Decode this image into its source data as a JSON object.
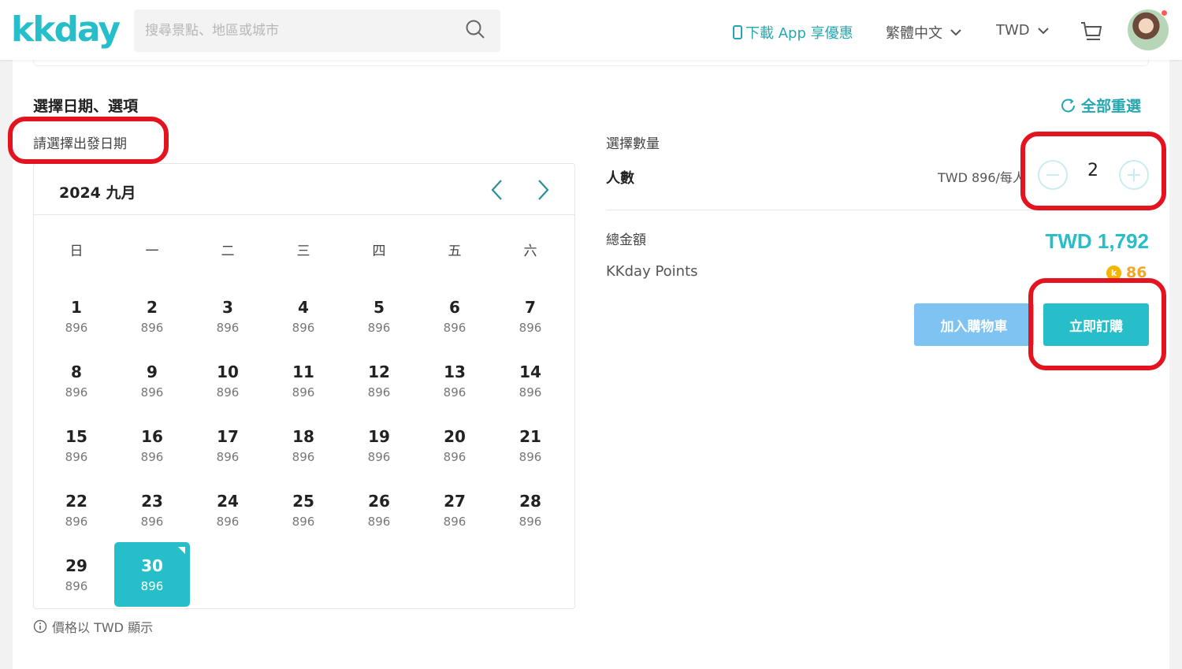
{
  "header": {
    "logo": "kkday",
    "search_placeholder": "搜尋景點、地區或城市",
    "app_link": "下載 App 享優惠",
    "language": "繁體中文",
    "currency": "TWD"
  },
  "booking": {
    "section_title": "選擇日期、選項",
    "reset_label": "全部重選",
    "date_prompt": "請選擇出發日期",
    "price_note": "價格以 TWD 顯示"
  },
  "calendar": {
    "month_label": "2024 九月",
    "weekdays": [
      "日",
      "一",
      "二",
      "三",
      "四",
      "五",
      "六"
    ],
    "selected_day": 30,
    "days": [
      {
        "day": "1",
        "price": "896"
      },
      {
        "day": "2",
        "price": "896"
      },
      {
        "day": "3",
        "price": "896"
      },
      {
        "day": "4",
        "price": "896"
      },
      {
        "day": "5",
        "price": "896"
      },
      {
        "day": "6",
        "price": "896"
      },
      {
        "day": "7",
        "price": "896"
      },
      {
        "day": "8",
        "price": "896"
      },
      {
        "day": "9",
        "price": "896"
      },
      {
        "day": "10",
        "price": "896"
      },
      {
        "day": "11",
        "price": "896"
      },
      {
        "day": "12",
        "price": "896"
      },
      {
        "day": "13",
        "price": "896"
      },
      {
        "day": "14",
        "price": "896"
      },
      {
        "day": "15",
        "price": "896"
      },
      {
        "day": "16",
        "price": "896"
      },
      {
        "day": "17",
        "price": "896"
      },
      {
        "day": "18",
        "price": "896"
      },
      {
        "day": "19",
        "price": "896"
      },
      {
        "day": "20",
        "price": "896"
      },
      {
        "day": "21",
        "price": "896"
      },
      {
        "day": "22",
        "price": "896"
      },
      {
        "day": "23",
        "price": "896"
      },
      {
        "day": "24",
        "price": "896"
      },
      {
        "day": "25",
        "price": "896"
      },
      {
        "day": "26",
        "price": "896"
      },
      {
        "day": "27",
        "price": "896"
      },
      {
        "day": "28",
        "price": "896"
      },
      {
        "day": "29",
        "price": "896"
      },
      {
        "day": "30",
        "price": "896"
      }
    ]
  },
  "quantity": {
    "label": "選擇數量",
    "person_label": "人數",
    "unit_price": "TWD 896/每人",
    "value": "2"
  },
  "summary": {
    "total_label": "總金額",
    "total_value": "TWD 1,792",
    "points_label": "KKday Points",
    "points_value": "86",
    "coin_symbol": "k"
  },
  "actions": {
    "add_to_cart": "加入購物車",
    "buy_now": "立即訂購"
  },
  "colors": {
    "brand": "#26bec9",
    "cart_button": "#7ec3f2",
    "annotation": "#e3141f",
    "points": "#f5a623"
  }
}
